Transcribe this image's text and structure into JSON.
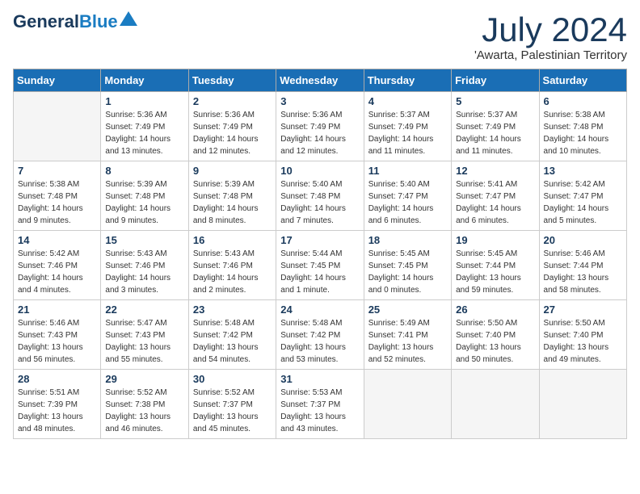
{
  "header": {
    "logo_general": "General",
    "logo_blue": "Blue",
    "month_title": "July 2024",
    "location": "'Awarta, Palestinian Territory"
  },
  "days_of_week": [
    "Sunday",
    "Monday",
    "Tuesday",
    "Wednesday",
    "Thursday",
    "Friday",
    "Saturday"
  ],
  "weeks": [
    [
      {
        "day": "",
        "sunrise": "",
        "sunset": "",
        "daylight": ""
      },
      {
        "day": "1",
        "sunrise": "Sunrise: 5:36 AM",
        "sunset": "Sunset: 7:49 PM",
        "daylight": "Daylight: 14 hours and 13 minutes."
      },
      {
        "day": "2",
        "sunrise": "Sunrise: 5:36 AM",
        "sunset": "Sunset: 7:49 PM",
        "daylight": "Daylight: 14 hours and 12 minutes."
      },
      {
        "day": "3",
        "sunrise": "Sunrise: 5:36 AM",
        "sunset": "Sunset: 7:49 PM",
        "daylight": "Daylight: 14 hours and 12 minutes."
      },
      {
        "day": "4",
        "sunrise": "Sunrise: 5:37 AM",
        "sunset": "Sunset: 7:49 PM",
        "daylight": "Daylight: 14 hours and 11 minutes."
      },
      {
        "day": "5",
        "sunrise": "Sunrise: 5:37 AM",
        "sunset": "Sunset: 7:49 PM",
        "daylight": "Daylight: 14 hours and 11 minutes."
      },
      {
        "day": "6",
        "sunrise": "Sunrise: 5:38 AM",
        "sunset": "Sunset: 7:48 PM",
        "daylight": "Daylight: 14 hours and 10 minutes."
      }
    ],
    [
      {
        "day": "7",
        "sunrise": "Sunrise: 5:38 AM",
        "sunset": "Sunset: 7:48 PM",
        "daylight": "Daylight: 14 hours and 9 minutes."
      },
      {
        "day": "8",
        "sunrise": "Sunrise: 5:39 AM",
        "sunset": "Sunset: 7:48 PM",
        "daylight": "Daylight: 14 hours and 9 minutes."
      },
      {
        "day": "9",
        "sunrise": "Sunrise: 5:39 AM",
        "sunset": "Sunset: 7:48 PM",
        "daylight": "Daylight: 14 hours and 8 minutes."
      },
      {
        "day": "10",
        "sunrise": "Sunrise: 5:40 AM",
        "sunset": "Sunset: 7:48 PM",
        "daylight": "Daylight: 14 hours and 7 minutes."
      },
      {
        "day": "11",
        "sunrise": "Sunrise: 5:40 AM",
        "sunset": "Sunset: 7:47 PM",
        "daylight": "Daylight: 14 hours and 6 minutes."
      },
      {
        "day": "12",
        "sunrise": "Sunrise: 5:41 AM",
        "sunset": "Sunset: 7:47 PM",
        "daylight": "Daylight: 14 hours and 6 minutes."
      },
      {
        "day": "13",
        "sunrise": "Sunrise: 5:42 AM",
        "sunset": "Sunset: 7:47 PM",
        "daylight": "Daylight: 14 hours and 5 minutes."
      }
    ],
    [
      {
        "day": "14",
        "sunrise": "Sunrise: 5:42 AM",
        "sunset": "Sunset: 7:46 PM",
        "daylight": "Daylight: 14 hours and 4 minutes."
      },
      {
        "day": "15",
        "sunrise": "Sunrise: 5:43 AM",
        "sunset": "Sunset: 7:46 PM",
        "daylight": "Daylight: 14 hours and 3 minutes."
      },
      {
        "day": "16",
        "sunrise": "Sunrise: 5:43 AM",
        "sunset": "Sunset: 7:46 PM",
        "daylight": "Daylight: 14 hours and 2 minutes."
      },
      {
        "day": "17",
        "sunrise": "Sunrise: 5:44 AM",
        "sunset": "Sunset: 7:45 PM",
        "daylight": "Daylight: 14 hours and 1 minute."
      },
      {
        "day": "18",
        "sunrise": "Sunrise: 5:45 AM",
        "sunset": "Sunset: 7:45 PM",
        "daylight": "Daylight: 14 hours and 0 minutes."
      },
      {
        "day": "19",
        "sunrise": "Sunrise: 5:45 AM",
        "sunset": "Sunset: 7:44 PM",
        "daylight": "Daylight: 13 hours and 59 minutes."
      },
      {
        "day": "20",
        "sunrise": "Sunrise: 5:46 AM",
        "sunset": "Sunset: 7:44 PM",
        "daylight": "Daylight: 13 hours and 58 minutes."
      }
    ],
    [
      {
        "day": "21",
        "sunrise": "Sunrise: 5:46 AM",
        "sunset": "Sunset: 7:43 PM",
        "daylight": "Daylight: 13 hours and 56 minutes."
      },
      {
        "day": "22",
        "sunrise": "Sunrise: 5:47 AM",
        "sunset": "Sunset: 7:43 PM",
        "daylight": "Daylight: 13 hours and 55 minutes."
      },
      {
        "day": "23",
        "sunrise": "Sunrise: 5:48 AM",
        "sunset": "Sunset: 7:42 PM",
        "daylight": "Daylight: 13 hours and 54 minutes."
      },
      {
        "day": "24",
        "sunrise": "Sunrise: 5:48 AM",
        "sunset": "Sunset: 7:42 PM",
        "daylight": "Daylight: 13 hours and 53 minutes."
      },
      {
        "day": "25",
        "sunrise": "Sunrise: 5:49 AM",
        "sunset": "Sunset: 7:41 PM",
        "daylight": "Daylight: 13 hours and 52 minutes."
      },
      {
        "day": "26",
        "sunrise": "Sunrise: 5:50 AM",
        "sunset": "Sunset: 7:40 PM",
        "daylight": "Daylight: 13 hours and 50 minutes."
      },
      {
        "day": "27",
        "sunrise": "Sunrise: 5:50 AM",
        "sunset": "Sunset: 7:40 PM",
        "daylight": "Daylight: 13 hours and 49 minutes."
      }
    ],
    [
      {
        "day": "28",
        "sunrise": "Sunrise: 5:51 AM",
        "sunset": "Sunset: 7:39 PM",
        "daylight": "Daylight: 13 hours and 48 minutes."
      },
      {
        "day": "29",
        "sunrise": "Sunrise: 5:52 AM",
        "sunset": "Sunset: 7:38 PM",
        "daylight": "Daylight: 13 hours and 46 minutes."
      },
      {
        "day": "30",
        "sunrise": "Sunrise: 5:52 AM",
        "sunset": "Sunset: 7:37 PM",
        "daylight": "Daylight: 13 hours and 45 minutes."
      },
      {
        "day": "31",
        "sunrise": "Sunrise: 5:53 AM",
        "sunset": "Sunset: 7:37 PM",
        "daylight": "Daylight: 13 hours and 43 minutes."
      },
      {
        "day": "",
        "sunrise": "",
        "sunset": "",
        "daylight": ""
      },
      {
        "day": "",
        "sunrise": "",
        "sunset": "",
        "daylight": ""
      },
      {
        "day": "",
        "sunrise": "",
        "sunset": "",
        "daylight": ""
      }
    ]
  ]
}
